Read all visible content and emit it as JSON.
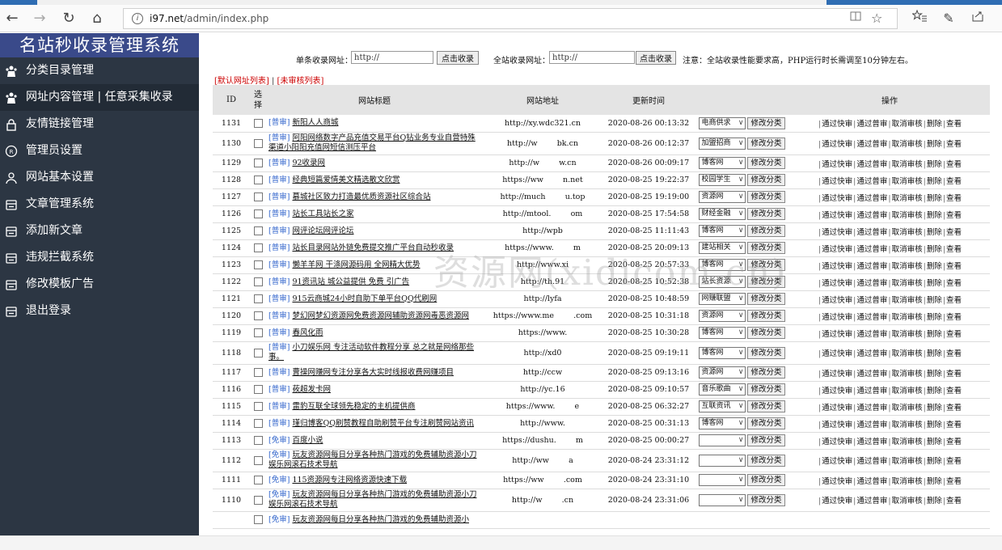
{
  "browser": {
    "url_host": "i97.net",
    "url_path": "/admin/index.php",
    "back": "←",
    "forward": "→",
    "reload": "↻",
    "home": "⌂",
    "reader": "📖",
    "favorite": "☆",
    "favorites": "☆≡",
    "notes": "✎",
    "share": "⇪"
  },
  "sidebar": {
    "brand": "名站秒收录管理系统",
    "items": [
      {
        "label": "分类目录管理",
        "icon": "users-icon"
      },
      {
        "label": "网址内容管理 | 任意采集收录",
        "icon": "users-icon",
        "active": true
      },
      {
        "label": "友情链接管理",
        "icon": "lock-icon"
      },
      {
        "label": "管理员设置",
        "icon": "admin-icon"
      },
      {
        "label": "网站基本设置",
        "icon": "user-icon"
      },
      {
        "label": "文章管理系统",
        "icon": "document-icon"
      },
      {
        "label": "添加新文章",
        "icon": "document-icon"
      },
      {
        "label": "违规拦截系统",
        "icon": "document-icon"
      },
      {
        "label": "修改模板广告",
        "icon": "document-icon"
      },
      {
        "label": "退出登录",
        "icon": "document-icon"
      }
    ]
  },
  "collect": {
    "single_label": "单条收录网址：",
    "single_value": "http://",
    "single_btn": "点击收录",
    "all_label": "全站收录网址：",
    "all_value": "http://",
    "all_btn": "点击收录",
    "note": "注意：全站收录性能要求高，PHP运行时长需调至10分钟左右。"
  },
  "list_links": {
    "default": "[默认网址列表]",
    "separator": " | ",
    "pending": "[未审核列表]"
  },
  "table": {
    "headers": {
      "id": "ID",
      "select": "选择",
      "title": "网站标题",
      "url": "网站地址",
      "time": "更新时间",
      "ops": "操作"
    },
    "modify_btn": "修改分类",
    "ops": [
      "通过快审",
      "通过普审",
      "取消审核",
      "删除",
      "查看"
    ],
    "rows": [
      {
        "id": "1131",
        "tag": "[普审]",
        "title": "新阳人人商城",
        "url": "http://xy.wdc321.cn",
        "time": "2020-08-26 00:13:32",
        "cat": "电商供求"
      },
      {
        "id": "1130",
        "tag": "[普审]",
        "title": "阿阳网络数字产品充值交易平台Q钻业务专业自营特殊渠道小阳阳充值网短信测压平台",
        "url": "http://w        bk.cn",
        "time": "2020-08-26 00:12:37",
        "cat": "加盟招商",
        "tall": true
      },
      {
        "id": "1129",
        "tag": "[普审]",
        "title": "92收录网",
        "url": "http://w        w.cn",
        "time": "2020-08-26 00:09:17",
        "cat": "博客网"
      },
      {
        "id": "1128",
        "tag": "[普审]",
        "title": "经典短篇爱情美文精选散文欣赏",
        "url": "https://ww        n.net",
        "time": "2020-08-25 19:22:37",
        "cat": "校园学生"
      },
      {
        "id": "1127",
        "tag": "[普审]",
        "title": "慕城社区致力打造最优质资源社区综合站",
        "url": "http://much        u.top",
        "time": "2020-08-25 19:19:00",
        "cat": "资源网"
      },
      {
        "id": "1126",
        "tag": "[普审]",
        "title": "站长工具站长之家",
        "url": "http://mtool.        om",
        "time": "2020-08-25 17:54:58",
        "cat": "财经金融"
      },
      {
        "id": "1125",
        "tag": "[普审]",
        "title": "网评论坛网评论坛",
        "url": "http://wpb",
        "time": "2020-08-25 11:11:43",
        "cat": "博客网"
      },
      {
        "id": "1124",
        "tag": "[普审]",
        "title": "站长目录网站外链免费提交推广平台自动秒收录",
        "url": "https://www.        m",
        "time": "2020-08-25 20:09:13",
        "cat": "建站相关"
      },
      {
        "id": "1123",
        "tag": "[普审]",
        "title": "懒羊羊网 干涤网源码用 全网精大优势",
        "url": "http://www.xi",
        "time": "2020-08-25 20:57:33",
        "cat": "博客网"
      },
      {
        "id": "1122",
        "tag": "[普审]",
        "title": "91资讯站 城公益提供 免费 引广告",
        "url": "http://th.91",
        "time": "2020-08-25 10:52:38",
        "cat": "站长资源"
      },
      {
        "id": "1121",
        "tag": "[普审]",
        "title": "915云商城24小时自助下单平台QQ代刷网",
        "url": "http://lyfa",
        "time": "2020-08-25 10:48:59",
        "cat": "网赚联盟"
      },
      {
        "id": "1120",
        "tag": "[普审]",
        "title": "梦幻网梦幻资源网免费资源网辅助资源网毒恶资源网",
        "url": "https://www.me        .com",
        "time": "2020-08-25 10:31:18",
        "cat": "资源网"
      },
      {
        "id": "1119",
        "tag": "[普审]",
        "title": "春风化雨",
        "url": "https://www.",
        "time": "2020-08-25 10:30:28",
        "cat": "博客网"
      },
      {
        "id": "1118",
        "tag": "[普审]",
        "title": "小刀娱乐网 专注活动软件教程分享 总之就是网络那些事。",
        "url": "http://xd0",
        "time": "2020-08-25 09:19:11",
        "cat": "博客网",
        "tall": true
      },
      {
        "id": "1117",
        "tag": "[普审]",
        "title": "曹操网赚网专注分享各大实时线报收费网赚项目",
        "url": "http://ccw",
        "time": "2020-08-25 09:13:16",
        "cat": "资源网"
      },
      {
        "id": "1116",
        "tag": "[普审]",
        "title": "莜超发卡网",
        "url": "http://yc.16",
        "time": "2020-08-25 09:10:57",
        "cat": "音乐歌曲"
      },
      {
        "id": "1115",
        "tag": "[普审]",
        "title": "雷豹互联全球领先稳定的主机提供商",
        "url": "https://www.        e",
        "time": "2020-08-25 06:32:27",
        "cat": "互联资讯"
      },
      {
        "id": "1114",
        "tag": "[普审]",
        "title": "瑾归博客QQ刷赞教程自助刷赞平台专注刷赞网站资讯",
        "url": "http://www.",
        "time": "2020-08-25 00:31:13",
        "cat": "博客网"
      },
      {
        "id": "1113",
        "tag": "[免审]",
        "title": "百度小说",
        "url": "https://dushu.        m",
        "time": "2020-08-25 00:00:27",
        "cat": ""
      },
      {
        "id": "1112",
        "tag": "[免审]",
        "title": "玩友资源网每日分享各种热门游戏的免费辅助资源小刀娱乐网滚石技术导航",
        "url": "http://ww        a",
        "time": "2020-08-24 23:31:12",
        "cat": "",
        "tall": true
      },
      {
        "id": "1111",
        "tag": "[免审]",
        "title": "115资源网专注网络资源快速下载",
        "url": "https://ww        .com",
        "time": "2020-08-24 23:31:10",
        "cat": ""
      },
      {
        "id": "1110",
        "tag": "[免审]",
        "title": "玩友资源网每日分享各种热门游戏的免费辅助资源小刀娱乐网滚石技术导航",
        "url": "http://w        .cn",
        "time": "2020-08-24 23:31:06",
        "cat": "",
        "tall": true
      },
      {
        "id": "",
        "tag": "[免审]",
        "title": "玩友资源网每日分享各种热门游戏的免费辅助资源小",
        "url": "",
        "time": "",
        "cat": ""
      }
    ]
  },
  "watermark": "资源网(xidicom.cn)"
}
